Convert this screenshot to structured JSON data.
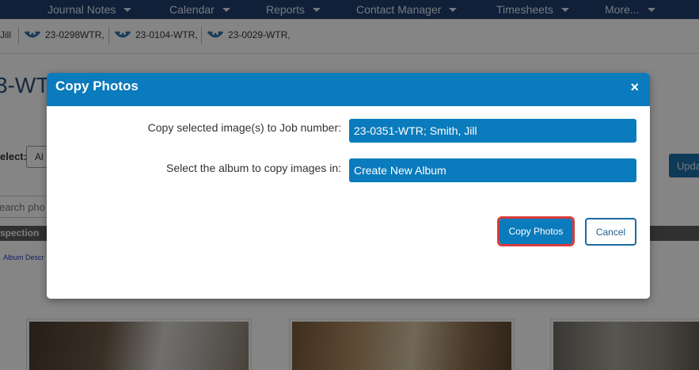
{
  "topnav": {
    "items": [
      {
        "label": "Journal Notes"
      },
      {
        "label": "Calendar"
      },
      {
        "label": "Reports"
      },
      {
        "label": "Contact Manager"
      },
      {
        "label": "Timesheets"
      },
      {
        "label": "More..."
      }
    ]
  },
  "recent_jobs": {
    "items": [
      {
        "label": "Jill"
      },
      {
        "label": "23-0298WTR,"
      },
      {
        "label": "23-0104-WTR,"
      },
      {
        "label": "23-0029-WTR,"
      }
    ]
  },
  "page": {
    "title_fragment": "3-WT",
    "select_label": "elect:",
    "select_value": "Al",
    "update_button": "Upda",
    "search_placeholder": "earch pho",
    "section_label": "spection",
    "album_description_link": "Album Descr"
  },
  "modal": {
    "title": "Copy Photos",
    "close_glyph": "×",
    "job_number_label": "Copy selected image(s) to Job number:",
    "job_number_value": "23-0351-WTR; Smith, Jill",
    "album_label": "Select the album to copy images in:",
    "album_value": "Create New Album",
    "copy_button": "Copy Photos",
    "cancel_button": "Cancel"
  },
  "icons": {
    "recent_job_icon": "water-drop-icon",
    "nav_caret": "caret-down-icon"
  },
  "colors": {
    "primary": "#0a7bbc",
    "nav_bg": "#1f3f6e",
    "highlight_outline": "#d93b3b"
  }
}
